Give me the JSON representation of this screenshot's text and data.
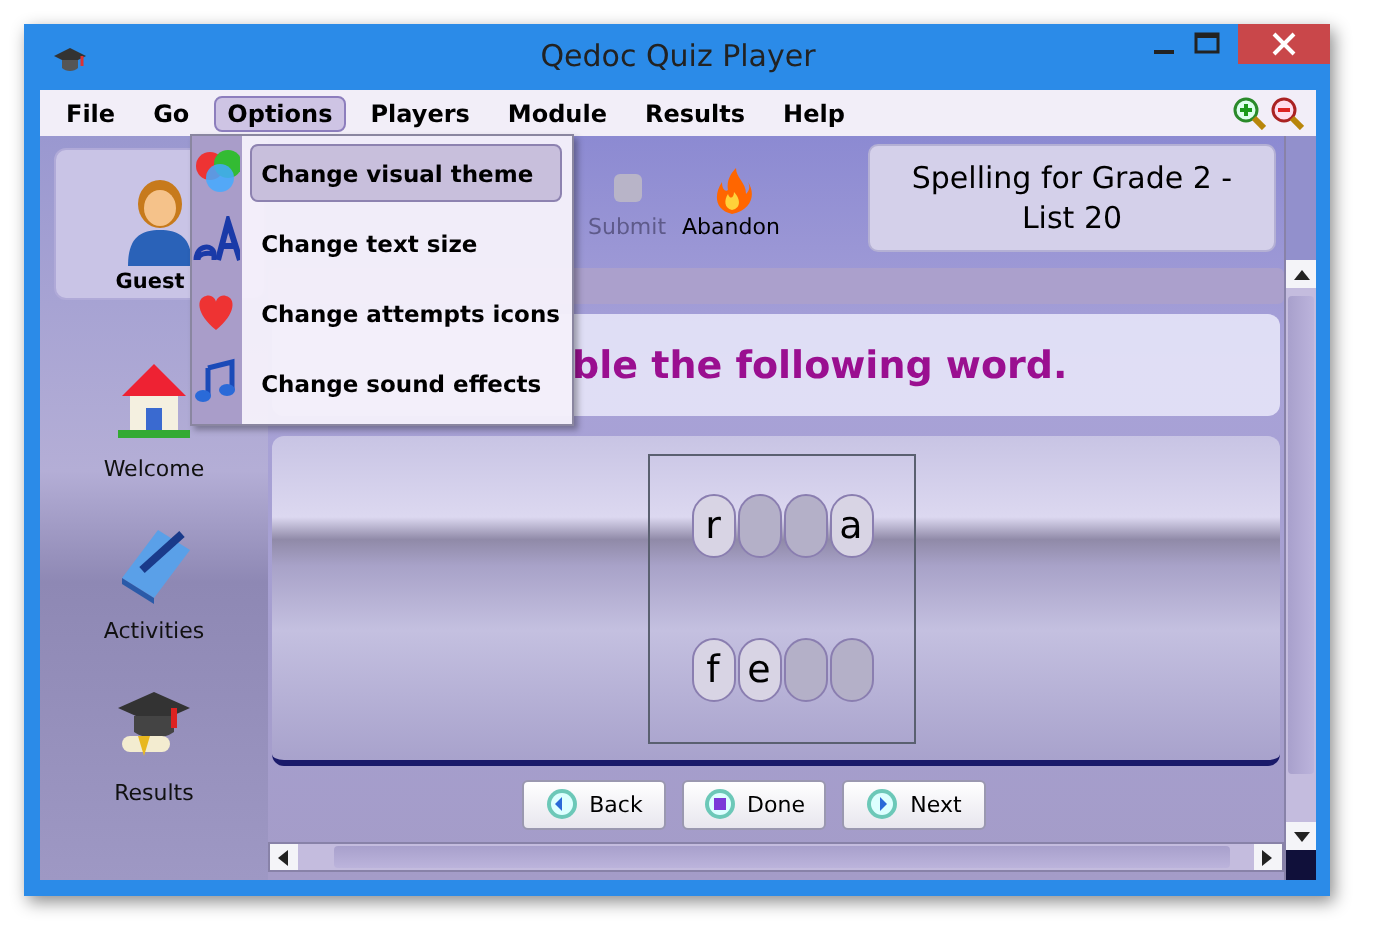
{
  "window": {
    "title": "Qedoc Quiz Player"
  },
  "menu": [
    {
      "label": "File",
      "selected": false
    },
    {
      "label": "Go",
      "selected": false
    },
    {
      "label": "Options",
      "selected": true
    },
    {
      "label": "Players",
      "selected": false
    },
    {
      "label": "Module",
      "selected": false
    },
    {
      "label": "Results",
      "selected": false
    },
    {
      "label": "Help",
      "selected": false
    }
  ],
  "sidebar": {
    "user": "Guest",
    "items": [
      {
        "label": "Welcome"
      },
      {
        "label": "Activities"
      },
      {
        "label": "Results"
      }
    ]
  },
  "toolbar": [
    {
      "label": "Submit",
      "disabled": true
    },
    {
      "label": "Abandon",
      "disabled": false
    }
  ],
  "module_title": "Spelling for Grade 2 - List 20",
  "prompt": "ble the following word.",
  "tiles": [
    [
      {
        "letter": "r",
        "filled": true
      },
      {
        "filled": false
      },
      {
        "filled": false
      },
      {
        "letter": "a",
        "filled": true
      }
    ],
    [
      {
        "letter": "f",
        "filled": true
      },
      {
        "letter": "e",
        "filled": true
      },
      {
        "filled": false
      },
      {
        "filled": false
      }
    ]
  ],
  "buttons": [
    {
      "label": "Back"
    },
    {
      "label": "Done"
    },
    {
      "label": "Next"
    }
  ],
  "options_menu": [
    {
      "label": "Change visual theme",
      "selected": true
    },
    {
      "label": "Change text size",
      "selected": false
    },
    {
      "label": "Change attempts icons",
      "selected": false
    },
    {
      "label": "Change sound effects",
      "selected": false
    }
  ]
}
